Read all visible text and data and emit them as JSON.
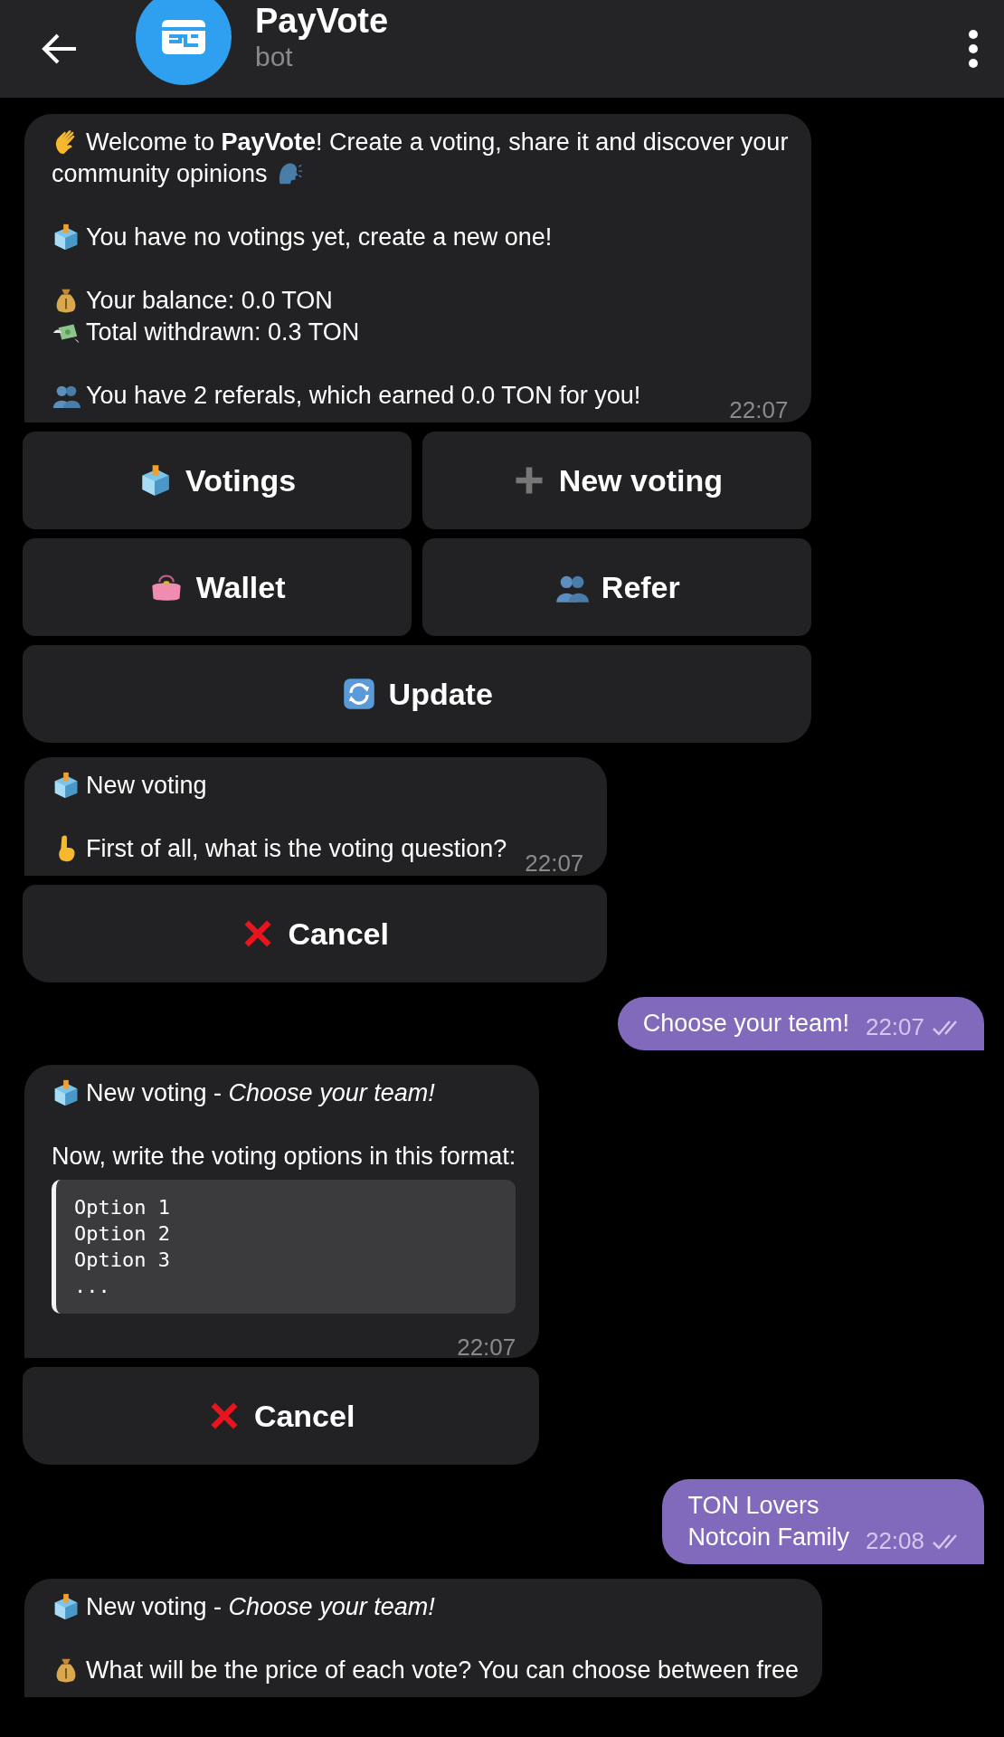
{
  "header": {
    "title": "PayVote",
    "subtitle": "bot"
  },
  "messages": [
    {
      "kind": "incoming",
      "time": "22:07",
      "paragraphs": [
        [
          {
            "kind": "wave",
            "text": "Welcome to **PayVote**! Create a voting, share it and discover your"
          },
          {
            "kind": "speaking-trail",
            "text": "community opinions"
          }
        ],
        [
          {
            "kind": "ballot",
            "text": "You have no votings yet, create a new one!"
          }
        ],
        [
          {
            "kind": "money-bag",
            "text": "Your balance: 0.0 TON"
          },
          {
            "kind": "flying-money",
            "text": "Total withdrawn: 0.3 TON"
          }
        ],
        [
          {
            "kind": "people",
            "text": "You have 2 referals, which earned 0.0 TON for you!"
          }
        ]
      ],
      "keyboard": [
        [
          {
            "kind": "ballot",
            "label": "Votings"
          },
          {
            "kind": "plus",
            "label": "New voting"
          }
        ],
        [
          {
            "kind": "purse",
            "label": "Wallet"
          },
          {
            "kind": "people",
            "label": "Refer"
          }
        ],
        [
          {
            "kind": "refresh",
            "label": "Update"
          }
        ]
      ]
    },
    {
      "kind": "incoming",
      "time": "22:07",
      "paragraphs": [
        [
          {
            "kind": "ballot",
            "text": "New voting"
          }
        ],
        [
          {
            "kind": "finger",
            "text": "First of all, what is the voting question?"
          }
        ]
      ],
      "keyboard": [
        [
          {
            "kind": "cross",
            "label": "Cancel"
          }
        ]
      ]
    },
    {
      "kind": "outgoing",
      "time": "22:07",
      "read": true,
      "text": "Choose your team!"
    },
    {
      "kind": "incoming",
      "time": "22:07",
      "paragraphs": [
        [
          {
            "kind": "ballot",
            "text": "New voting - *Choose your team!*"
          }
        ],
        [
          {
            "kind": "plain",
            "text": "Now, write the voting options in this format:"
          },
          {
            "kind": "code",
            "text": "Option 1\nOption 2\nOption 3\n..."
          }
        ]
      ],
      "keyboard": [
        [
          {
            "kind": "cross",
            "label": "Cancel"
          }
        ]
      ]
    },
    {
      "kind": "outgoing",
      "time": "22:08",
      "read": true,
      "text": "TON Lovers\nNotcoin Family"
    },
    {
      "kind": "incoming",
      "paragraphs": [
        [
          {
            "kind": "ballot",
            "text": "New voting - *Choose your team!*"
          }
        ],
        [
          {
            "kind": "money-bag",
            "text": "What will be the price of each vote? You can choose between free"
          }
        ]
      ]
    }
  ]
}
